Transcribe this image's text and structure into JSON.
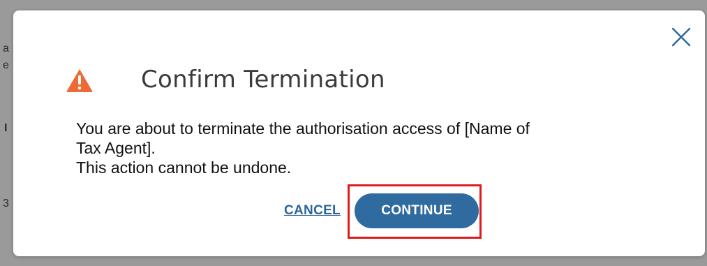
{
  "modal": {
    "title": "Confirm Termination",
    "message_line1": "You are about to terminate the authorisation access of [Name of",
    "message_line2": "Tax Agent].",
    "message_line3": "This action cannot be undone.",
    "cancel_label": "CANCEL",
    "continue_label": "CONTINUE",
    "icon_warning": "warning-icon",
    "icon_close": "close-icon"
  },
  "colors": {
    "primary_button": "#2f6b9f",
    "link": "#2c6699",
    "warning": "#ee6a35",
    "highlight": "#e01b1b",
    "backdrop": "#9a9a9a"
  }
}
